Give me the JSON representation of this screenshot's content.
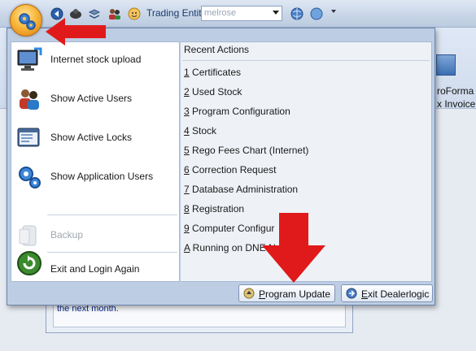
{
  "colors": {
    "annotation_red": "#e01a1a",
    "menu_frame": "#bdcde3",
    "orb_orange": "#f8b83b"
  },
  "toolbar": {
    "entity_label": "Trading Entity",
    "entity_value": "melrose",
    "icons": [
      "back-icon",
      "car-icon",
      "stack-icon",
      "people-icon",
      "face-icon",
      "globe-icon",
      "circle-icon"
    ]
  },
  "background": {
    "ribbon_text_1": "roForma",
    "ribbon_text_2": "x Invoice",
    "panel_text": "the next month."
  },
  "menu": {
    "left_items": [
      {
        "label": "Internet stock upload",
        "icon": "monitor-upload-icon"
      },
      {
        "label": "Show Active Users",
        "icon": "users-icon"
      },
      {
        "label": "Show Active Locks",
        "icon": "lock-window-icon"
      },
      {
        "label": "Show Application Users",
        "icon": "gears-icon"
      },
      {
        "label": "Backup",
        "icon": "backup-icon",
        "disabled": true
      },
      {
        "label": "Exit and Login Again",
        "icon": "relogin-icon"
      }
    ],
    "recent_title": "Recent Actions",
    "recent": [
      {
        "key": "1",
        "text": " Certificates"
      },
      {
        "key": "2",
        "text": " Used Stock"
      },
      {
        "key": "3",
        "text": " Program Configuration"
      },
      {
        "key": "4",
        "text": " Stock"
      },
      {
        "key": "5",
        "text": " Rego Fees Chart (Internet)"
      },
      {
        "key": "6",
        "text": " Correction Request"
      },
      {
        "key": "7",
        "text": " Database Administration"
      },
      {
        "key": "8",
        "text": " Registration"
      },
      {
        "key": "9",
        "text": " Computer Configur"
      },
      {
        "key": "A",
        "text": " Running on DNE N"
      }
    ],
    "program_update": {
      "accel": "P",
      "rest": "rogram Update"
    },
    "exit": {
      "accel": "E",
      "rest": "xit Dealerlogic"
    }
  }
}
